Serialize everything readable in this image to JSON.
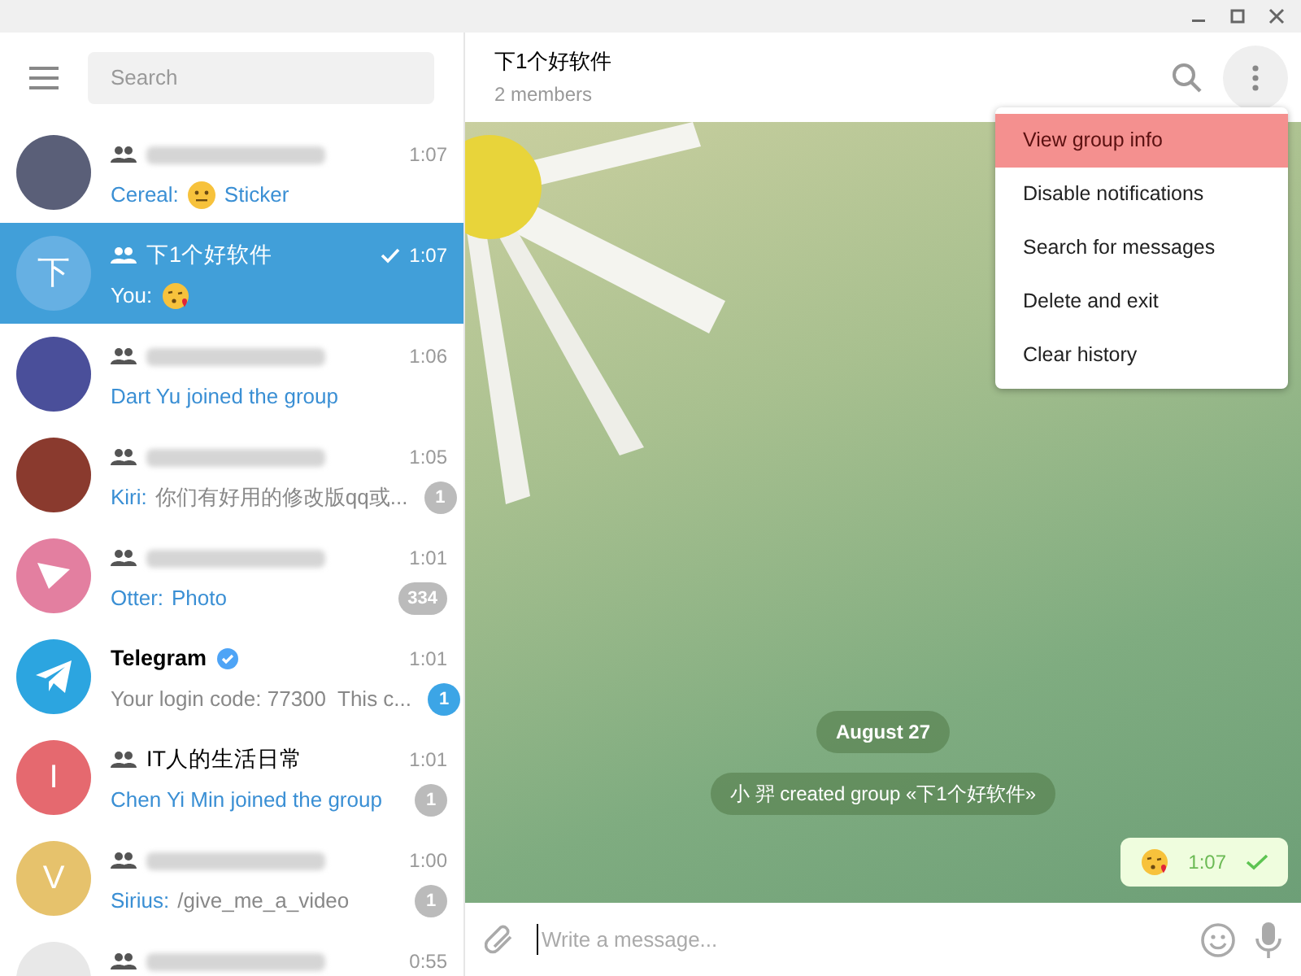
{
  "search": {
    "placeholder": "Search"
  },
  "chats": [
    {
      "avatar": {
        "kind": "photo",
        "color": "#5a5f78"
      },
      "group": true,
      "name_redacted": true,
      "time": "1:07",
      "preview": [
        {
          "kind": "sender",
          "text": "Cereal:"
        },
        {
          "kind": "neutral"
        },
        {
          "kind": "link",
          "text": "Sticker"
        }
      ],
      "selected": false
    },
    {
      "avatar": {
        "kind": "letter",
        "letter": "下",
        "color": "#66b0e3"
      },
      "group": true,
      "name": "下1个好软件",
      "time": "1:07",
      "sent_check": true,
      "preview": [
        {
          "kind": "sender",
          "text": "You:"
        },
        {
          "kind": "kiss"
        }
      ],
      "selected": true
    },
    {
      "avatar": {
        "kind": "photo",
        "color": "#4a4f9a"
      },
      "group": true,
      "name_redacted": true,
      "time": "1:06",
      "preview": [
        {
          "kind": "link",
          "text": "Dart Yu joined the group"
        }
      ],
      "selected": false
    },
    {
      "avatar": {
        "kind": "photo",
        "color": "#8a3a2e"
      },
      "group": true,
      "name_redacted": true,
      "time": "1:05",
      "preview": [
        {
          "kind": "sender",
          "text": "Kiri:"
        },
        {
          "kind": "plain",
          "text": "你们有好用的修改版qq或..."
        }
      ],
      "badge": "1",
      "badge_muted": true,
      "selected": false
    },
    {
      "avatar": {
        "kind": "plane",
        "color": "#e37fa0"
      },
      "group": true,
      "name_redacted": true,
      "time": "1:01",
      "preview": [
        {
          "kind": "sender",
          "text": "Otter:"
        },
        {
          "kind": "link",
          "text": "Photo"
        }
      ],
      "badge": "334",
      "badge_muted": true,
      "selected": false
    },
    {
      "avatar": {
        "kind": "telegram",
        "color": "#2ca5e0"
      },
      "group": false,
      "name": "Telegram",
      "verified": true,
      "time": "1:01",
      "preview": [
        {
          "kind": "plain",
          "text": "Your login code: 77300  This c..."
        }
      ],
      "badge": "1",
      "badge_muted": false,
      "selected": false
    },
    {
      "avatar": {
        "kind": "letter",
        "letter": "I",
        "color": "#e5696f"
      },
      "group": true,
      "name": "IT人的生活日常",
      "time": "1:01",
      "preview": [
        {
          "kind": "link",
          "text": "Chen Yi Min joined the group"
        }
      ],
      "badge": "1",
      "badge_muted": true,
      "selected": false
    },
    {
      "avatar": {
        "kind": "letter",
        "letter": "V",
        "color": "#e6c26c"
      },
      "group": true,
      "name_redacted": true,
      "time": "1:00",
      "preview": [
        {
          "kind": "sender",
          "text": "Sirius:"
        },
        {
          "kind": "plain",
          "text": "/give_me_a_video"
        }
      ],
      "badge": "1",
      "badge_muted": true,
      "selected": false
    },
    {
      "avatar": {
        "kind": "photo",
        "color": "#e8e8e8"
      },
      "group": true,
      "name_redacted": true,
      "time": "0:55",
      "selected": false
    }
  ],
  "chat": {
    "title": "下1个好软件",
    "subtitle": "2 members",
    "service": [
      "August 27",
      "小 羿 created group «下1个好软件»"
    ],
    "message": {
      "kind": "kiss",
      "time": "1:07",
      "read": true
    },
    "composer": {
      "placeholder": "Write a message..."
    }
  },
  "menu": [
    {
      "label": "View group info",
      "selected": true
    },
    {
      "label": "Disable notifications",
      "selected": false
    },
    {
      "label": "Search for messages",
      "selected": false
    },
    {
      "label": "Delete and exit",
      "selected": false
    },
    {
      "label": "Clear history",
      "selected": false
    }
  ]
}
